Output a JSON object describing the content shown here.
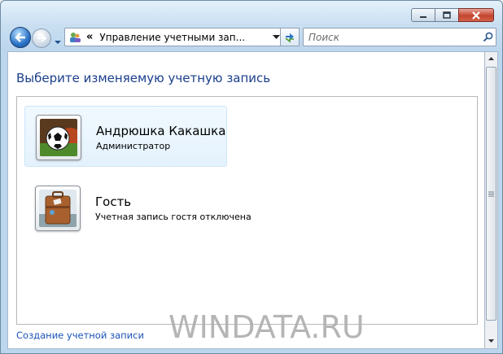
{
  "navbar": {
    "address_chevron": "«",
    "address_text": "Управление учетными зап...",
    "search_placeholder": "Поиск"
  },
  "page": {
    "title": "Выберите изменяемую учетную запись",
    "create_link": "Создание учетной записи",
    "watermark": "WINDATA.RU"
  },
  "accounts": [
    {
      "name": "Андрюшка Какашка",
      "role": "Администратор",
      "picture": "soccer-ball-icon",
      "selected": true
    },
    {
      "name": "Гость",
      "role": "Учетная запись гостя отключена",
      "picture": "suitcase-icon",
      "selected": false
    }
  ],
  "colors": {
    "title": "#1a3e8c",
    "link": "#1a53b8",
    "selection": "#e4f2fd"
  }
}
